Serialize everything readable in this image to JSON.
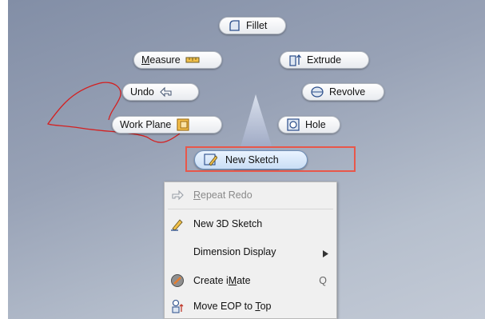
{
  "marking_menu": {
    "fillet": "Fillet",
    "measure": {
      "pre": "M",
      "rest": "easure"
    },
    "extrude": "Extrude",
    "undo": "Undo",
    "revolve": "Revolve",
    "work_plane": "Work Plane",
    "hole": "Hole",
    "new_sketch": "New Sketch"
  },
  "context_menu": {
    "repeat_redo": {
      "pre": "",
      "u": "R",
      "rest": "epeat Redo"
    },
    "new_3d_sketch": "New 3D Sketch",
    "dimension_display": "Dimension Display",
    "create_imate": {
      "pre": "Create i",
      "u": "M",
      "rest": "ate"
    },
    "create_imate_shortcut": "Q",
    "move_eop": {
      "pre": "Move EOP to ",
      "u": "T",
      "rest": "op"
    }
  },
  "colors": {
    "highlight": "#e8574a",
    "annotation_stroke": "#d42020",
    "viewport_top": "#828ea6",
    "viewport_bottom": "#c3cad6"
  }
}
